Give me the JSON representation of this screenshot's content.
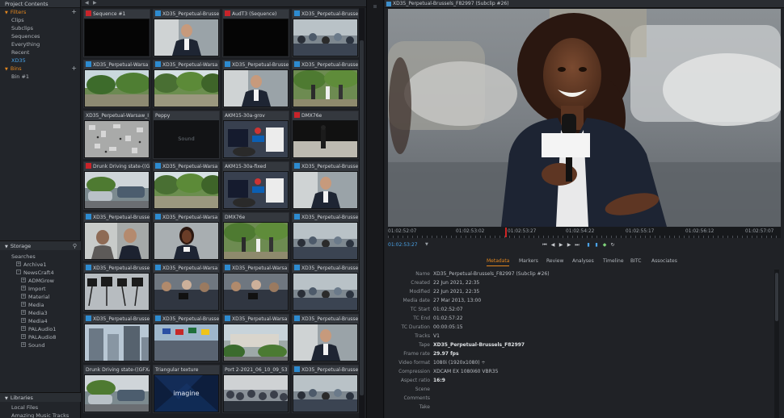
{
  "sidebar": {
    "title": "Project Contents",
    "filters_label": "Filters",
    "filters": [
      "Clips",
      "Subclips",
      "Sequences",
      "Everything",
      "Recent",
      "XD35"
    ],
    "bins_label": "Bins",
    "bins": [
      "Bin #1"
    ],
    "storage_label": "Storage",
    "storage": [
      {
        "label": "Searches",
        "indent": 0,
        "box": ""
      },
      {
        "label": "Archive1",
        "indent": 1,
        "box": "+"
      },
      {
        "label": "NewsCraft4",
        "indent": 1,
        "box": "-"
      },
      {
        "label": "ADMGrow",
        "indent": 2,
        "box": "+"
      },
      {
        "label": "Import",
        "indent": 2,
        "box": "+"
      },
      {
        "label": "Material",
        "indent": 2,
        "box": "+"
      },
      {
        "label": "Media",
        "indent": 2,
        "box": "+"
      },
      {
        "label": "Media3",
        "indent": 2,
        "box": "+"
      },
      {
        "label": "Media4",
        "indent": 2,
        "box": "+"
      },
      {
        "label": "PALAudio1",
        "indent": 2,
        "box": "+"
      },
      {
        "label": "PALAudio8",
        "indent": 2,
        "box": "+"
      },
      {
        "label": "Sound",
        "indent": 2,
        "box": "+"
      }
    ],
    "libraries_label": "Libraries",
    "libraries": [
      "Local Files",
      "Amazing Music Tracks"
    ]
  },
  "clips": [
    {
      "title": "Sequence #1",
      "flag": "#c8242a",
      "thumb": "black"
    },
    {
      "title": "XD35_Perpetual-Brusse",
      "flag": "#2d8bd0",
      "thumb": "reporter-m"
    },
    {
      "title": "AudT3 (Sequence)",
      "flag": "#c8242a",
      "thumb": "black"
    },
    {
      "title": "XD35_Perpetual-Brusse",
      "flag": "#2d8bd0",
      "thumb": "crowd"
    },
    {
      "title": "XD35_Perpetual-Warsa",
      "flag": "#2d8bd0",
      "thumb": "park"
    },
    {
      "title": "XD35_Perpetual-Warsa",
      "flag": "#2d8bd0",
      "thumb": "park2"
    },
    {
      "title": "XD35_Perpetual-Brussels_F",
      "flag": "#2d8bd0",
      "thumb": "reporter-m"
    },
    {
      "title": "XD35_Perpetual-Brusse",
      "flag": "#2d8bd0",
      "thumb": "park-people"
    },
    {
      "title": "XD35_Perpetual-Warsaw_I",
      "flag": "",
      "thumb": "aerial"
    },
    {
      "title": "Peppy",
      "flag": "",
      "thumb": "sound"
    },
    {
      "title": "AKM15-30a-grov",
      "flag": "",
      "thumb": "mics"
    },
    {
      "title": "DMX76e",
      "flag": "#c8242a",
      "thumb": "dark-street"
    },
    {
      "title": "Drunk Driving state-((G",
      "flag": "#c8242a",
      "thumb": "cars"
    },
    {
      "title": "XD35_Perpetual-Warsa",
      "flag": "#2d8bd0",
      "thumb": "park2"
    },
    {
      "title": "AKM15-30a-fixed",
      "flag": "",
      "thumb": "mics"
    },
    {
      "title": "XD35_Perpetual-Brusse",
      "flag": "#2d8bd0",
      "thumb": "reporter-m"
    },
    {
      "title": "XD35_Perpetual-Brusse",
      "flag": "#2d8bd0",
      "thumb": "interview"
    },
    {
      "title": "XD35_Perpetual-Warsa",
      "flag": "#2d8bd0",
      "thumb": "reporter-f"
    },
    {
      "title": "DMX76e",
      "flag": "",
      "thumb": "park-people"
    },
    {
      "title": "XD35_Perpetual-Brusse",
      "flag": "#2d8bd0",
      "thumb": "crowd"
    },
    {
      "title": "XD35_Perpetual-Brusse",
      "flag": "#2d8bd0",
      "thumb": "cameras"
    },
    {
      "title": "XD35_Perpetual-Warsa",
      "flag": "#2d8bd0",
      "thumb": "press"
    },
    {
      "title": "XD35_Perpetual-Warsa",
      "flag": "#2d8bd0",
      "thumb": "press"
    },
    {
      "title": "XD35_Perpetual-Brusse",
      "flag": "#2d8bd0",
      "thumb": "crowd"
    },
    {
      "title": "XD35_Perpetual-Brusse",
      "flag": "#2d8bd0",
      "thumb": "buildings"
    },
    {
      "title": "XD35_Perpetual-Brusse",
      "flag": "#2d8bd0",
      "thumb": "flags"
    },
    {
      "title": "XD35_Perpetual-Warsa",
      "flag": "#2d8bd0",
      "thumb": "city"
    },
    {
      "title": "XD35_Perpetual-Brusse",
      "flag": "#2d8bd0",
      "thumb": "reporter-m"
    },
    {
      "title": "Drunk Driving state-((GFXA",
      "flag": "",
      "thumb": "cars"
    },
    {
      "title": "Triangular texture",
      "flag": "",
      "thumb": "imagine"
    },
    {
      "title": "Port 2-2021_06_10_09_53",
      "flag": "",
      "thumb": "crowd2"
    },
    {
      "title": "XD35_Perpetual-Brusse",
      "flag": "#2d8bd0",
      "thumb": "crowd"
    }
  ],
  "sound_label": "Sound",
  "imagine_label": "imagine",
  "viewer": {
    "title": "XD35_Perpetual-Brussels_F82997 (Subclip #26)",
    "timecodes": [
      "01:02:52:07",
      "01:02:53:02",
      "01:02:53:27",
      "01:02:54:22",
      "01:02:55:17",
      "01:02:56:12",
      "01:02:57:07"
    ],
    "current_tc": "01:02:53:27"
  },
  "tabs": [
    "Metadata",
    "Markers",
    "Review",
    "Analyses",
    "Timeline",
    "BITC",
    "Associates"
  ],
  "active_tab": "Metadata",
  "metadata": [
    {
      "k": "Name",
      "v": "XD35_Perpetual-Brussels_F82997 (Subclip #26)",
      "bold": false
    },
    {
      "k": "Created",
      "v": "22 Jun 2021, 22:35",
      "bold": false
    },
    {
      "k": "Modified",
      "v": "22 Jun 2021, 22:35",
      "bold": false
    },
    {
      "k": "Media date",
      "v": "27 Mar 2013, 13:00",
      "bold": false
    },
    {
      "k": "TC Start",
      "v": "01:02:52:07",
      "bold": false
    },
    {
      "k": "TC End",
      "v": "01:02:57:22",
      "bold": false
    },
    {
      "k": "TC Duration",
      "v": "00:00:05:15",
      "bold": false
    },
    {
      "k": "Tracks",
      "v": "V1",
      "bold": false
    },
    {
      "k": "Tape",
      "v": "XD35_Perpetual-Brussels_F82997",
      "bold": true
    },
    {
      "k": "Frame rate",
      "v": "29.97 fps",
      "bold": true
    },
    {
      "k": "Video format",
      "v": "1080i (1920x1080) ÷",
      "bold": false
    },
    {
      "k": "Compression",
      "v": "XDCAM EX 1080i60 VBR35",
      "bold": false
    },
    {
      "k": "Aspect ratio",
      "v": "16:9",
      "bold": true
    },
    {
      "k": "Scene",
      "v": "",
      "bold": false
    },
    {
      "k": "Comments",
      "v": "",
      "bold": false
    },
    {
      "k": "Take",
      "v": "",
      "bold": false
    }
  ]
}
